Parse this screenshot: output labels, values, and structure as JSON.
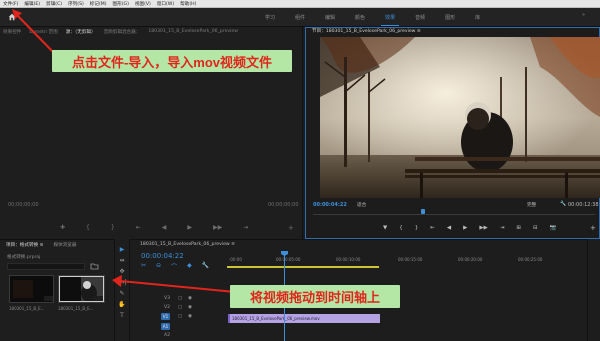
{
  "menu": [
    "文件(F)",
    "编辑(E)",
    "剪辑(C)",
    "序列(S)",
    "标记(M)",
    "图形(G)",
    "视图(V)",
    "窗口(W)",
    "帮助(H)"
  ],
  "workspaces": {
    "tabs": [
      "学习",
      "组件",
      "编辑",
      "颜色",
      "效果",
      "音频",
      "图形",
      "库"
    ],
    "active_index": 4,
    "more": "»"
  },
  "source_panel": {
    "tabs": [
      "效果控件",
      "Lumetri 范围",
      "源：（无剪辑）",
      "音频剪辑混合器：",
      "180301_15_B_EvelosePark_06_preview"
    ],
    "active_index": 2,
    "timecode_left": "00;00;00;00",
    "timecode_right": "00;00;00;00",
    "controls": [
      "✚",
      "{",
      "}",
      "⇤",
      "◀",
      "▶",
      "▶▶",
      "⇥",
      "⊞",
      "⊟",
      "📷"
    ],
    "add_label": "+"
  },
  "program_panel": {
    "title": "节目：180301_15_B_EvelosePark_06_preview ≡",
    "timecode": "00:00:04:22",
    "fit": "适合",
    "full": "完整",
    "wrench": "🔧",
    "timecode_right": "00:00:12:38",
    "controls": [
      "▼",
      "{",
      "}",
      "⇤",
      "◀",
      "▶",
      "▶▶",
      "⇥",
      "⊞",
      "⊟",
      "📷"
    ],
    "add_label": "+",
    "playhead_fraction": 0.38
  },
  "project_panel": {
    "tabs": [
      "项目：格式转换 ≡",
      "媒体浏览器"
    ],
    "active_index": 0,
    "name": "格式转换.prproj",
    "search_icon": "folder-search-icon",
    "items": [
      {
        "label": "180301_15_B_E...",
        "duration": ""
      },
      {
        "label": "180301_15_B_E...",
        "duration": "13:08"
      }
    ]
  },
  "tools": [
    "▶",
    "⇹",
    "✥",
    "|↔|",
    "✎",
    "✋",
    "T"
  ],
  "active_tool_index": 0,
  "timeline": {
    "title": "180301_15_B_EvelosePark_06_preview ≡",
    "timecode": "00:00:04:22",
    "tool_icons": [
      "✂",
      "⊖",
      "⌒",
      "◆",
      "🔧"
    ],
    "ruler": [
      ":00:00",
      "00:00:05:00",
      "00:00:10:00",
      "00:00:15:00",
      "00:00:20:00",
      "00:00:25:00"
    ],
    "tracks": [
      {
        "label": "V3",
        "target": false
      },
      {
        "label": "V2",
        "target": false
      },
      {
        "label": "V1",
        "target": true
      },
      {
        "label": "A1",
        "target": true
      },
      {
        "label": "A2",
        "target": false
      },
      {
        "label": "A3",
        "target": false
      }
    ],
    "clip_label": "180301_15_B_EvelosePark_06_preview.mov"
  },
  "annotations": {
    "note1": "点击文件-导入，导入mov视频文件",
    "note2": "将视频拖动到时间轴上",
    "note_color": "#b4e7a5",
    "text_color": "#e0261c"
  },
  "colors": {
    "accent": "#3d8fd9",
    "clip": "#b5a2e2",
    "workarea": "#c9c434"
  }
}
